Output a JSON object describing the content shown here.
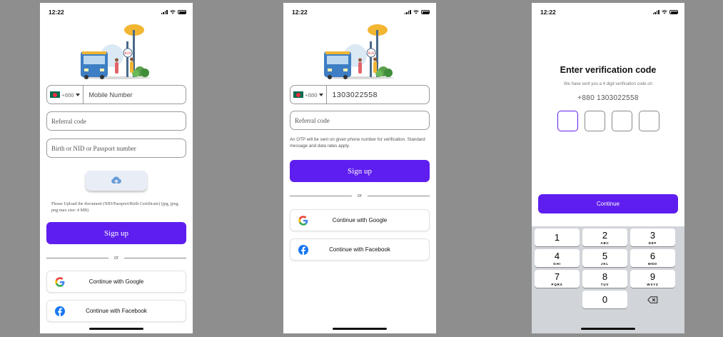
{
  "status": {
    "time": "12:22"
  },
  "screen1": {
    "country_code": "+880",
    "mobile_placeholder": "Mobile Number",
    "referral_placeholder": "Referral code",
    "id_placeholder": "Birth or NID or Passport  number",
    "upload_note": "Please Upload the document (NID/Passport/Birth Certificate) (jpg, jpeg, png max size: 4 MB)",
    "signup_label": "Sign up",
    "or_label": "or",
    "google_label": "Continue with Google",
    "facebook_label": "Continue with Facebook"
  },
  "screen2": {
    "country_code": "+880",
    "mobile_value": "1303022558",
    "referral_placeholder": "Referral code",
    "otp_note": "An OTP will be sent on given phone number for verification. Standard message and data rates apply.",
    "signup_label": "Sign up",
    "or_label": "or",
    "google_label": "Continue with Google",
    "facebook_label": "Continue with Facebook"
  },
  "screen3": {
    "title": "Enter verification code",
    "subtitle": "We have sent you a 4 digit verification code on",
    "phone": "+880 1303022558",
    "continue_label": "Continue",
    "keys": [
      {
        "digit": "1",
        "letters": ""
      },
      {
        "digit": "2",
        "letters": "ABC"
      },
      {
        "digit": "3",
        "letters": "DEF"
      },
      {
        "digit": "4",
        "letters": "GHI"
      },
      {
        "digit": "5",
        "letters": "JKL"
      },
      {
        "digit": "6",
        "letters": "MNO"
      },
      {
        "digit": "7",
        "letters": "PQRS"
      },
      {
        "digit": "8",
        "letters": "TUV"
      },
      {
        "digit": "9",
        "letters": "WXYZ"
      },
      {
        "digit": "0",
        "letters": ""
      }
    ]
  },
  "colors": {
    "primary": "#5f1ef0",
    "google_blue": "#4285F4",
    "facebook_blue": "#1877F2"
  },
  "icons": [
    "signal-icon",
    "wifi-icon",
    "battery-icon",
    "upload-cloud-icon",
    "google-icon",
    "facebook-icon",
    "backspace-icon"
  ]
}
